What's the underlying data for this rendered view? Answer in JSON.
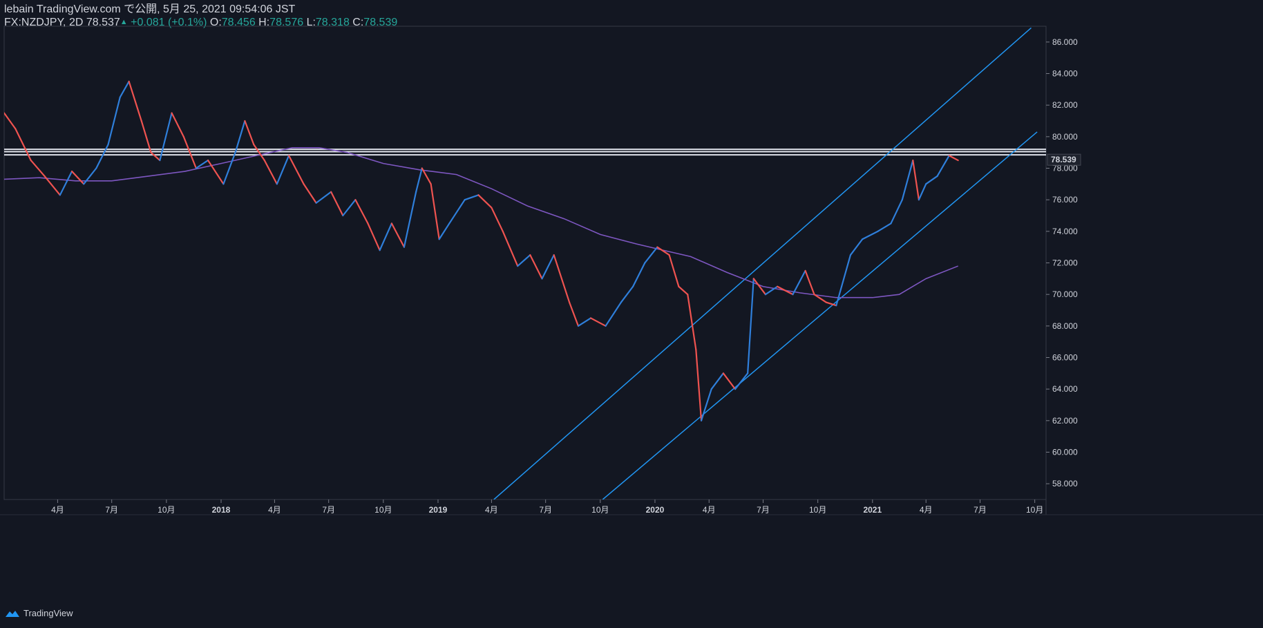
{
  "header": {
    "line1": "lebain TradingView.com で公開, 5月 25, 2021 09:54:06 JST",
    "symbol": "FX:NZDJPY, 2D",
    "last": "78.537",
    "change": "+0.081 (+0.1%)",
    "o_label": "O:",
    "o_value": "78.456",
    "h_label": "H:",
    "h_value": "78.576",
    "l_label": "L:",
    "l_value": "78.318",
    "c_label": "C:",
    "c_value": "78.539"
  },
  "footer": {
    "brand": "TradingView"
  },
  "colors": {
    "background": "#131722",
    "up": "#2f7fdb",
    "down": "#ef5350",
    "ma": "#7e57c2",
    "channel": "#2196f3",
    "level": "#e0e3eb",
    "text": "#d1d4dc"
  },
  "chart_data": {
    "type": "line",
    "title": "",
    "xlabel": "",
    "ylabel": "",
    "ylim": [
      57,
      87
    ],
    "y_ticks": [
      "58.000",
      "60.000",
      "62.000",
      "64.000",
      "66.000",
      "68.000",
      "70.000",
      "72.000",
      "74.000",
      "76.000",
      "78.000",
      "80.000",
      "82.000",
      "84.000",
      "86.000"
    ],
    "last_price_label": "78.539",
    "x_ticks": [
      "4月",
      "7月",
      "10月",
      "2018",
      "4月",
      "7月",
      "10月",
      "2019",
      "4月",
      "7月",
      "10月",
      "2020",
      "4月",
      "7月",
      "10月",
      "2021",
      "4月",
      "7月",
      "10月"
    ],
    "x_tick_dates": [
      "2017-04-01",
      "2017-07-01",
      "2017-10-01",
      "2018-01-01",
      "2018-04-01",
      "2018-07-01",
      "2018-10-01",
      "2019-01-01",
      "2019-04-01",
      "2019-07-01",
      "2019-10-01",
      "2020-01-01",
      "2020-04-01",
      "2020-07-01",
      "2020-10-01",
      "2021-01-01",
      "2021-04-01",
      "2021-07-01",
      "2021-10-01"
    ],
    "series": [
      {
        "kind": "price",
        "x": [
          "2017-01-01",
          "2017-01-20",
          "2017-02-15",
          "2017-03-10",
          "2017-04-05",
          "2017-04-25",
          "2017-05-15",
          "2017-06-05",
          "2017-06-25",
          "2017-07-15",
          "2017-07-30",
          "2017-08-20",
          "2017-09-05",
          "2017-09-20",
          "2017-10-10",
          "2017-10-30",
          "2017-11-20",
          "2017-12-10",
          "2018-01-05",
          "2018-01-25",
          "2018-02-10",
          "2018-02-25",
          "2018-03-15",
          "2018-04-05",
          "2018-04-25",
          "2018-05-20",
          "2018-06-10",
          "2018-07-05",
          "2018-07-25",
          "2018-08-15",
          "2018-09-05",
          "2018-09-25",
          "2018-10-15",
          "2018-11-05",
          "2018-11-25",
          "2018-12-05",
          "2018-12-20",
          "2019-01-03",
          "2019-01-20",
          "2019-02-15",
          "2019-03-10",
          "2019-04-01",
          "2019-04-20",
          "2019-05-15",
          "2019-06-05",
          "2019-06-25",
          "2019-07-15",
          "2019-08-10",
          "2019-08-25",
          "2019-09-15",
          "2019-10-10",
          "2019-11-05",
          "2019-11-25",
          "2019-12-15",
          "2020-01-05",
          "2020-01-25",
          "2020-02-10",
          "2020-02-25",
          "2020-03-10",
          "2020-03-19",
          "2020-04-05",
          "2020-04-25",
          "2020-05-15",
          "2020-06-05",
          "2020-06-15",
          "2020-07-05",
          "2020-07-25",
          "2020-08-20",
          "2020-09-10",
          "2020-09-25",
          "2020-10-15",
          "2020-11-01",
          "2020-11-10",
          "2020-11-25",
          "2020-12-15",
          "2021-01-10",
          "2021-02-01",
          "2021-02-20",
          "2021-03-10",
          "2021-03-20",
          "2021-04-01",
          "2021-04-20",
          "2021-05-10",
          "2021-05-25"
        ],
        "values": [
          81.5,
          80.5,
          78.5,
          77.5,
          76.3,
          77.8,
          77.0,
          78.0,
          79.5,
          82.5,
          83.5,
          81.0,
          79.0,
          78.5,
          81.5,
          80.0,
          78.0,
          78.5,
          77.0,
          79.0,
          81.0,
          79.5,
          78.5,
          77.0,
          78.8,
          77.0,
          75.8,
          76.5,
          75.0,
          76.0,
          74.5,
          72.8,
          74.5,
          73.0,
          76.5,
          78.0,
          77.0,
          73.5,
          74.5,
          76.0,
          76.3,
          75.5,
          74.0,
          71.8,
          72.5,
          71.0,
          72.5,
          69.5,
          68.0,
          68.5,
          68.0,
          69.5,
          70.5,
          72.0,
          73.0,
          72.5,
          70.5,
          70.0,
          66.5,
          62.0,
          64.0,
          65.0,
          64.0,
          65.0,
          71.0,
          70.0,
          70.5,
          70.0,
          71.5,
          70.0,
          69.5,
          69.3,
          70.5,
          72.5,
          73.5,
          74.0,
          74.5,
          76.0,
          78.5,
          76.0,
          77.0,
          77.5,
          78.8,
          78.5
        ]
      },
      {
        "kind": "moving_average",
        "x": [
          "2017-01-01",
          "2017-03-01",
          "2017-05-01",
          "2017-07-01",
          "2017-09-01",
          "2017-11-01",
          "2018-01-01",
          "2018-03-01",
          "2018-05-01",
          "2018-06-15",
          "2018-08-01",
          "2018-10-01",
          "2018-12-01",
          "2019-02-01",
          "2019-04-01",
          "2019-06-01",
          "2019-08-01",
          "2019-10-01",
          "2019-12-01",
          "2020-01-15",
          "2020-03-01",
          "2020-05-01",
          "2020-07-01",
          "2020-09-01",
          "2020-11-01",
          "2021-01-01",
          "2021-02-15",
          "2021-04-01",
          "2021-05-25"
        ],
        "values": [
          77.3,
          77.4,
          77.2,
          77.2,
          77.5,
          77.8,
          78.3,
          78.8,
          79.3,
          79.3,
          79.0,
          78.3,
          77.9,
          77.6,
          76.7,
          75.6,
          74.8,
          73.8,
          73.2,
          72.8,
          72.4,
          71.4,
          70.5,
          70.1,
          69.8,
          69.8,
          70.0,
          71.0,
          71.8
        ]
      }
    ],
    "horizontal_levels": [
      79.2,
      79.05,
      78.85
    ],
    "channel_lines": [
      {
        "x": [
          "2019-04-05",
          "2021-09-25"
        ],
        "y": [
          57.0,
          86.9
        ]
      },
      {
        "x": [
          "2019-10-05",
          "2021-10-05"
        ],
        "y": [
          57.0,
          80.3
        ]
      }
    ]
  }
}
